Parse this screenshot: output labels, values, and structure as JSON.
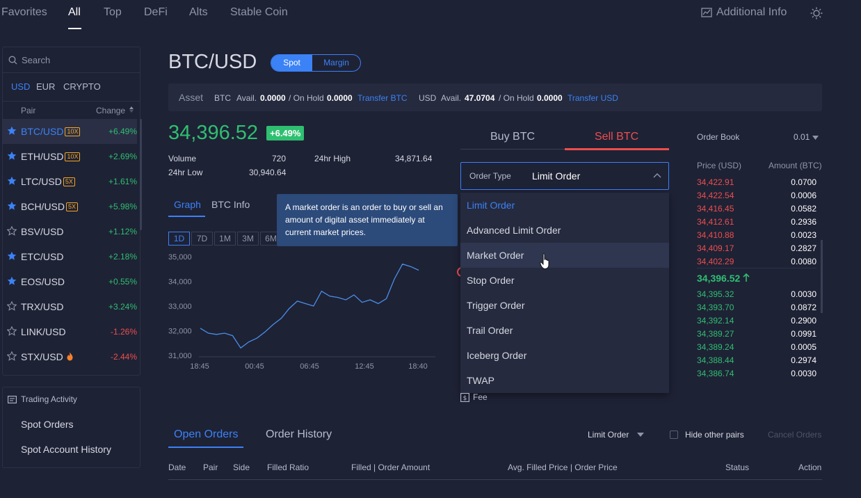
{
  "nav": {
    "tabs": [
      "Favorites",
      "All",
      "Top",
      "DeFi",
      "Alts",
      "Stable Coin"
    ],
    "active_tab": "All",
    "additional_info": "Additional Info"
  },
  "sidebar": {
    "search_placeholder": "Search",
    "currencies": [
      "USD",
      "EUR",
      "CRYPTO"
    ],
    "active_currency": "USD",
    "col_pair": "Pair",
    "col_change": "Change",
    "pairs": [
      {
        "symbol": "BTC/USD",
        "leverage": "10X",
        "change": "+6.49%",
        "favorite": true,
        "selected": true
      },
      {
        "symbol": "ETH/USD",
        "leverage": "10X",
        "change": "+2.69%",
        "favorite": true
      },
      {
        "symbol": "LTC/USD",
        "leverage": "5X",
        "change": "+1.61%",
        "favorite": true
      },
      {
        "symbol": "BCH/USD",
        "leverage": "5X",
        "change": "+5.98%",
        "favorite": true
      },
      {
        "symbol": "BSV/USD",
        "leverage": "",
        "change": "+1.12%",
        "favorite": false
      },
      {
        "symbol": "ETC/USD",
        "leverage": "",
        "change": "+2.18%",
        "favorite": true
      },
      {
        "symbol": "EOS/USD",
        "leverage": "",
        "change": "+0.55%",
        "favorite": true
      },
      {
        "symbol": "TRX/USD",
        "leverage": "",
        "change": "+3.24%",
        "favorite": false
      },
      {
        "symbol": "LINK/USD",
        "leverage": "",
        "change": "-1.26%",
        "favorite": false
      },
      {
        "symbol": "STX/USD",
        "leverage": "",
        "change": "-2.44%",
        "favorite": false,
        "hot": true
      }
    ]
  },
  "activity": {
    "title": "Trading Activity",
    "links": [
      "Spot Orders",
      "Spot Account History"
    ]
  },
  "header": {
    "pair": "BTC/USD",
    "mode_spot": "Spot",
    "mode_margin": "Margin"
  },
  "assets": {
    "label": "Asset",
    "btc_code": "BTC",
    "btc_avail_label": "Avail.",
    "btc_avail": "0.0000",
    "btc_hold_label": "/ On Hold",
    "btc_hold": "0.0000",
    "btc_transfer": "Transfer BTC",
    "usd_code": "USD",
    "usd_avail_label": "Avail.",
    "usd_avail": "47.0704",
    "usd_hold_label": "/ On Hold",
    "usd_hold": "0.0000",
    "usd_transfer": "Transfer USD"
  },
  "ticker": {
    "price": "34,396.52",
    "change": "+6.49%",
    "volume_label": "Volume",
    "volume": "720",
    "high_label": "24hr High",
    "high": "34,871.64",
    "low_label": "24hr Low",
    "low": "30,940.64"
  },
  "graph": {
    "tabs": [
      "Graph",
      "BTC Info"
    ],
    "ranges": [
      "1D",
      "7D",
      "1M",
      "3M",
      "6M"
    ],
    "active_range": "1D"
  },
  "chart_data": {
    "type": "line",
    "ylim": [
      31000,
      35000
    ],
    "yticks": [
      "35,000",
      "34,000",
      "33,000",
      "32,000",
      "31,000"
    ],
    "xticks": [
      "18:45",
      "00:45",
      "06:45",
      "12:45",
      "18:40"
    ],
    "series": [
      {
        "values": [
          32100,
          31900,
          31850,
          31900,
          31800,
          31300,
          31550,
          31700,
          31950,
          32250,
          32500,
          32900,
          33200,
          33100,
          33000,
          33600,
          33400,
          33350,
          33250,
          33450,
          33150,
          33250,
          33100,
          33300,
          34100,
          34700,
          34600,
          34450
        ]
      }
    ]
  },
  "tooltip": {
    "text": "A market order is an order to buy or sell an amount of digital asset immediately at current market prices."
  },
  "order_form": {
    "buy_tab": "Buy BTC",
    "sell_tab": "Sell BTC",
    "order_type_label": "Order Type",
    "order_type_value": "Limit Order",
    "options": [
      "Limit Order",
      "Advanced Limit Order",
      "Market Order",
      "Stop Order",
      "Trigger Order",
      "Trail Order",
      "Iceberg Order",
      "TWAP"
    ],
    "fee_label": "Fee"
  },
  "order_book": {
    "title": "Order Book",
    "step": "0.01",
    "col_price": "Price (USD)",
    "col_amount": "Amount (BTC)",
    "asks": [
      {
        "price": "34,422.91",
        "amount": "0.0700"
      },
      {
        "price": "34,422.54",
        "amount": "0.0006"
      },
      {
        "price": "34,416.45",
        "amount": "0.0582"
      },
      {
        "price": "34,412.61",
        "amount": "0.2936"
      },
      {
        "price": "34,410.88",
        "amount": "0.0023"
      },
      {
        "price": "34,409.17",
        "amount": "0.2827"
      },
      {
        "price": "34,402.29",
        "amount": "0.0080"
      }
    ],
    "mid": "34,396.52",
    "bids": [
      {
        "price": "34,395.32",
        "amount": "0.0030"
      },
      {
        "price": "34,393.70",
        "amount": "0.0872"
      },
      {
        "price": "34,392.14",
        "amount": "0.2900"
      },
      {
        "price": "34,389.27",
        "amount": "0.0991"
      },
      {
        "price": "34,389.24",
        "amount": "0.0005"
      },
      {
        "price": "34,388.44",
        "amount": "0.2974"
      },
      {
        "price": "34,386.74",
        "amount": "0.0030"
      }
    ]
  },
  "orders": {
    "tabs": [
      "Open Orders",
      "Order History"
    ],
    "filter": "Limit Order",
    "hide_other_pairs": "Hide other pairs",
    "cancel_orders": "Cancel Orders",
    "columns": [
      "Date",
      "Pair",
      "Side",
      "Filled Ratio",
      "Filled | Order Amount",
      "Avg. Filled Price | Order Price",
      "Status",
      "Action"
    ]
  }
}
